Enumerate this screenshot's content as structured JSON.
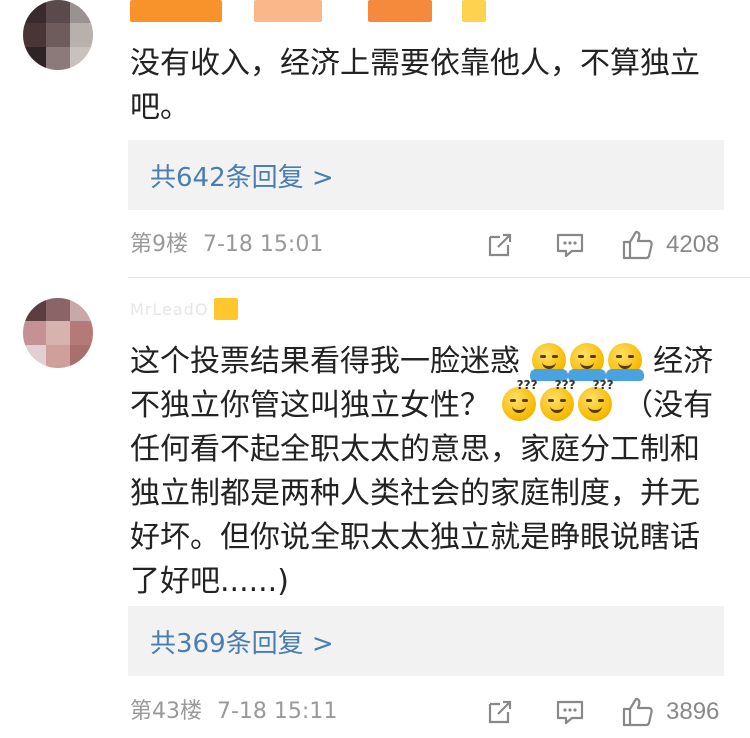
{
  "comments": [
    {
      "username": "",
      "content": "没有收入，经济上需要依靠他人，不算独立吧。",
      "replies_label": "共642条回复 >",
      "floor": "第9楼",
      "time": "7-18 15:01",
      "likes": "4208",
      "avatar_colors": [
        "#3a2a2e",
        "#5b4a4c",
        "#9a9290",
        "#4a3536",
        "#6e5c5d",
        "#b8b0ad",
        "#2e2425",
        "#8c7a7a",
        "#c9c1bd"
      ],
      "name_colors": [
        "#f7932a",
        "#f9b78a",
        "#f58a3c",
        "#ffd24d"
      ]
    },
    {
      "username": "MrLeadO",
      "content_before": "这个投票结果看得我一脸迷惑",
      "content_middle": "经济不独立你管这叫独立女性？",
      "content_after": "（没有任何看不起全职太太的意思，家庭分工制和独立制都是两种人类社会的家庭制度，并无好坏。但你说全职太太独立就是睁眼说瞎话了好吧......)",
      "replies_label": "共369条回复 >",
      "floor": "第43楼",
      "time": "7-18 15:11",
      "likes": "3896",
      "avatar_colors": [
        "#5a3e40",
        "#8a6466",
        "#c8a8a8",
        "#c49294",
        "#d7b3b0",
        "#b47a78",
        "#e3cfd1",
        "#cf9f9c",
        "#a8706c"
      ],
      "emojis_shrug": [
        "shrug-emoji",
        "shrug-emoji",
        "shrug-emoji"
      ],
      "emojis_dizzy": [
        "dizzy-emoji",
        "dizzy-emoji",
        "dizzy-emoji"
      ],
      "badge_color": "#ffc72b"
    }
  ],
  "colors": {
    "link": "#4a7db0",
    "meta": "#999999",
    "reply_bg": "#f2f2f2"
  }
}
